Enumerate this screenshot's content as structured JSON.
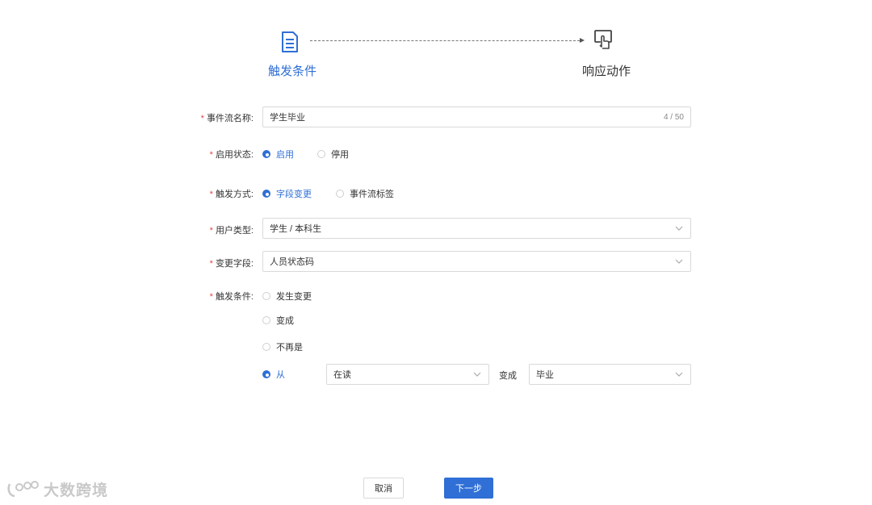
{
  "steps": {
    "trigger_label": "触发条件",
    "response_label": "响应动作"
  },
  "form": {
    "name": {
      "label": "事件流名称:",
      "value": "学生毕业",
      "counter": "4 / 50"
    },
    "status": {
      "label": "启用状态:",
      "options": [
        "启用",
        "停用"
      ],
      "selected": "启用"
    },
    "trigger_mode": {
      "label": "触发方式:",
      "options": [
        "字段变更",
        "事件流标签"
      ],
      "selected": "字段变更"
    },
    "user_type": {
      "label": "用户类型:",
      "value": "学生 / 本科生"
    },
    "change_field": {
      "label": "变更字段:",
      "value": "人员状态码"
    },
    "trigger_condition": {
      "label": "触发条件:",
      "options": [
        "发生变更",
        "变成",
        "不再是",
        "从"
      ],
      "selected": "从",
      "from_value": "在读",
      "to_label": "变成",
      "to_value": "毕业"
    }
  },
  "footer": {
    "cancel_label": "取消",
    "next_label": "下一步"
  },
  "watermark": {
    "text": "大数跨境"
  },
  "colors": {
    "accent": "#2f6fd6",
    "required": "#e54545",
    "border": "#d9d9d9"
  }
}
